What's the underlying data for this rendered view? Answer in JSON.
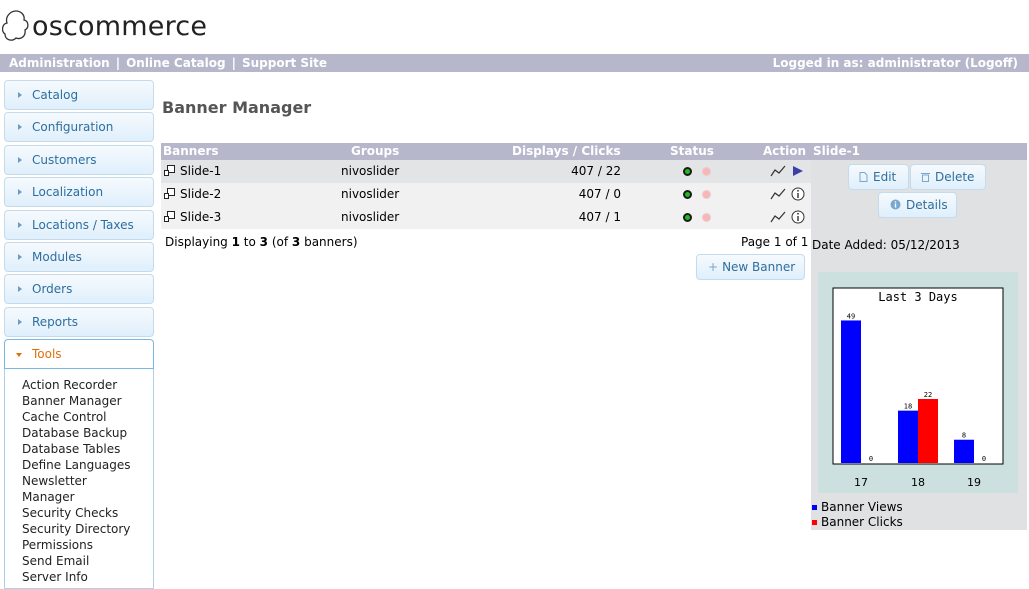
{
  "brand": {
    "logo_text": "oscommerce"
  },
  "topbar": {
    "links": [
      "Administration",
      "Online Catalog",
      "Support Site"
    ],
    "separator": "|",
    "user_prefix": "Logged in as: administrator",
    "logoff": "(Logoff)"
  },
  "sidebar": {
    "sections": [
      "Catalog",
      "Configuration",
      "Customers",
      "Localization",
      "Locations / Taxes",
      "Modules",
      "Orders",
      "Reports"
    ],
    "active": "Tools",
    "tools_items": [
      "Action Recorder",
      "Banner Manager",
      "Cache Control",
      "Database Backup",
      "Database Tables",
      "Define Languages",
      "Newsletter",
      "Manager",
      "Security Checks",
      "Security Directory",
      "Permissions",
      "Send Email",
      "Server Info"
    ]
  },
  "page": {
    "title": "Banner Manager"
  },
  "grid": {
    "headers": {
      "banners": "Banners",
      "groups": "Groups",
      "displays": "Displays / Clicks",
      "status": "Status",
      "action": "Action"
    },
    "rows": [
      {
        "name": "Slide-1",
        "group": "nivoslider",
        "displays": "407 / 22",
        "action_icon": "arrow-right-icon"
      },
      {
        "name": "Slide-2",
        "group": "nivoslider",
        "displays": "407 / 0",
        "action_icon": "info-icon"
      },
      {
        "name": "Slide-3",
        "group": "nivoslider",
        "displays": "407 / 1",
        "action_icon": "info-icon"
      }
    ],
    "displaying_prefix": "Displaying ",
    "displaying_from": "1",
    "displaying_to_word": " to ",
    "displaying_to": "3",
    "displaying_of_prefix": " (of ",
    "displaying_total": "3",
    "displaying_suffix": " banners)",
    "page_info": "Page 1 of 1",
    "new_banner": "New Banner"
  },
  "info": {
    "title": "Slide-1",
    "edit": "Edit",
    "delete": "Delete",
    "details": "Details",
    "date_added": "Date Added: 05/12/2013"
  },
  "chart_data": {
    "type": "bar",
    "title": "Last 3 Days",
    "categories": [
      "17",
      "18",
      "19"
    ],
    "series": [
      {
        "name": "Banner Views",
        "values": [
          49,
          18,
          8
        ],
        "color": "#0000ff"
      },
      {
        "name": "Banner Clicks",
        "values": [
          0,
          22,
          0
        ],
        "color": "#ff0000"
      }
    ],
    "ylim": [
      0,
      55
    ]
  }
}
